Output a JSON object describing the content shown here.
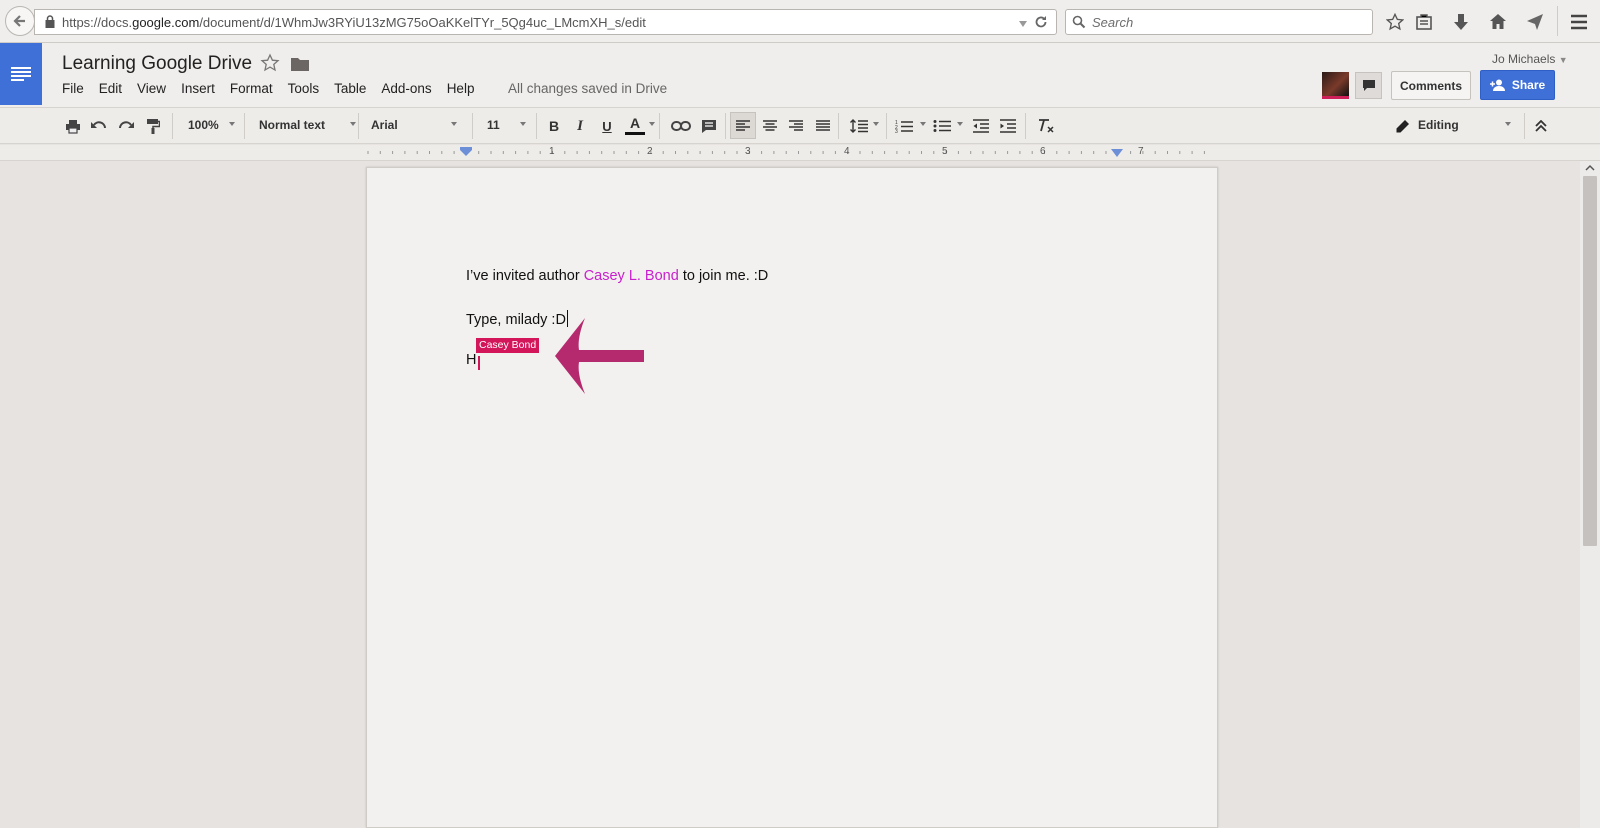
{
  "browser": {
    "url_prefix": "https://docs.",
    "url_domain": "google.com",
    "url_path": "/document/d/1WhmJw3RYiU13zMG75oOaKKelTYr_5Qg4uc_LMcmXH_s/edit",
    "search_placeholder": "Search"
  },
  "header": {
    "title": "Learning Google Drive",
    "menu": [
      "File",
      "Edit",
      "View",
      "Insert",
      "Format",
      "Tools",
      "Table",
      "Add-ons",
      "Help"
    ],
    "save_status": "All changes saved in Drive",
    "user_name": "Jo Michaels",
    "comments_label": "Comments",
    "share_label": "Share",
    "logo_color": "#3f70d8"
  },
  "toolbar": {
    "zoom": "100%",
    "style": "Normal text",
    "font": "Arial",
    "size": "11",
    "bold": "B",
    "italic": "I",
    "underline": "U",
    "text_color": "A",
    "mode": "Editing"
  },
  "ruler": {
    "labels": [
      "1",
      "2",
      "3",
      "4",
      "5",
      "6",
      "7"
    ]
  },
  "document": {
    "line1_before": "I’ve invited author ",
    "line1_name": "Casey L. Bond",
    "line1_after": " to join me. :D",
    "line2": "Type, milady :D",
    "line3": "H",
    "collaborator_label": "Casey Bond",
    "name_color": "#c81fcd",
    "collaborator_color": "#d3155a"
  }
}
